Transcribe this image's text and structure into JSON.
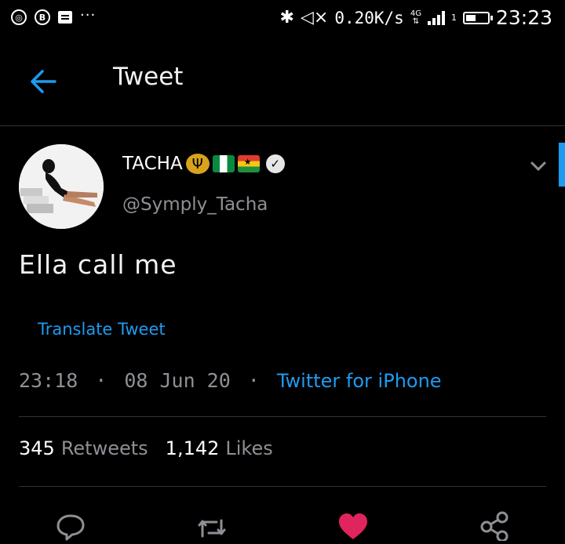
{
  "status_bar": {
    "left_icons": [
      "vpn-icon",
      "b-icon",
      "message-icon",
      "more-icon"
    ],
    "b_label": "B",
    "dots": "···",
    "net_speed": "0.20K/s",
    "network": "4G",
    "sim_slot": "1",
    "time": "23:23"
  },
  "header": {
    "title": "Tweet"
  },
  "tweet": {
    "display_name": "TACHA",
    "handle": "@Symply_Tacha",
    "text": "Ella call me",
    "translate_label": "Translate Tweet",
    "time": "23:18",
    "date": "08 Jun 20",
    "source": "Twitter for iPhone",
    "separator": "·"
  },
  "stats": {
    "retweets_count": "345",
    "retweets_label": "Retweets",
    "likes_count": "1,142",
    "likes_label": "Likes"
  },
  "colors": {
    "accent": "#1d9bf0",
    "like": "#e0245e",
    "muted": "#8d9095"
  }
}
